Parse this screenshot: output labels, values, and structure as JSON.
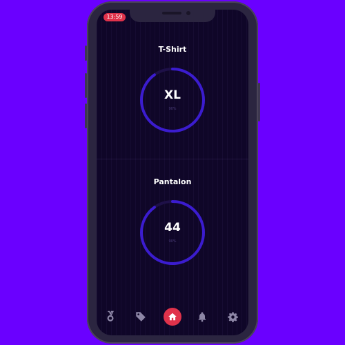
{
  "status_bar": {
    "time": "13:59"
  },
  "sections": [
    {
      "title": "T-Shirt",
      "value": "XL",
      "percent_label": "90%",
      "progress": 0.9
    },
    {
      "title": "Pantalon",
      "value": "44",
      "percent_label": "90%",
      "progress": 0.9
    }
  ],
  "nav": {
    "items": [
      {
        "icon": "medal-icon"
      },
      {
        "icon": "tag-icon"
      },
      {
        "icon": "home-icon",
        "active": true
      },
      {
        "icon": "bell-icon"
      },
      {
        "icon": "gear-icon"
      }
    ]
  },
  "colors": {
    "background": "#6a00ff",
    "screen": "#0f0628",
    "gauge_track": "#1e1048",
    "gauge_fill": "#3b1ccf",
    "accent": "#e0324b",
    "icon": "#8d86a6"
  }
}
